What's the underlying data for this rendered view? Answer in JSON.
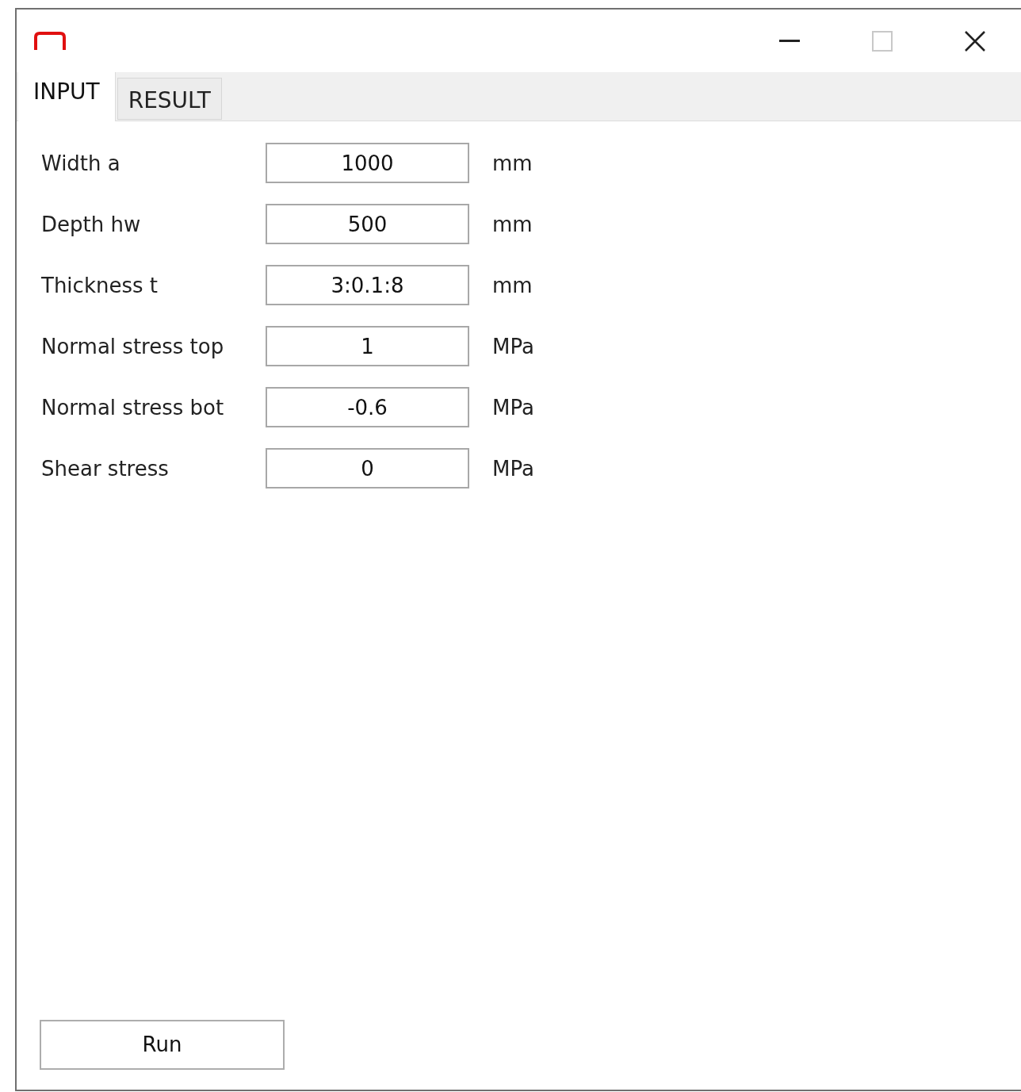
{
  "window": {
    "controls": [
      {
        "kind": "minimize",
        "disabled": false
      },
      {
        "kind": "maximize",
        "disabled": true
      },
      {
        "kind": "close",
        "disabled": false
      }
    ]
  },
  "tabs": [
    {
      "label": "INPUT",
      "selected": true
    },
    {
      "label": "RESULT",
      "selected": false
    }
  ],
  "fields": [
    {
      "label": "Width a",
      "value": "1000",
      "unit": "mm"
    },
    {
      "label": "Depth hw",
      "value": "500",
      "unit": "mm"
    },
    {
      "label": "Thickness t",
      "value": "3:0.1:8",
      "unit": "mm"
    },
    {
      "label": "Normal stress top",
      "value": "1",
      "unit": "MPa"
    },
    {
      "label": "Normal stress bot",
      "value": "-0.6",
      "unit": "MPa"
    },
    {
      "label": "Shear stress",
      "value": "0",
      "unit": "MPa"
    }
  ],
  "buttons": [
    {
      "label": "Run"
    }
  ]
}
